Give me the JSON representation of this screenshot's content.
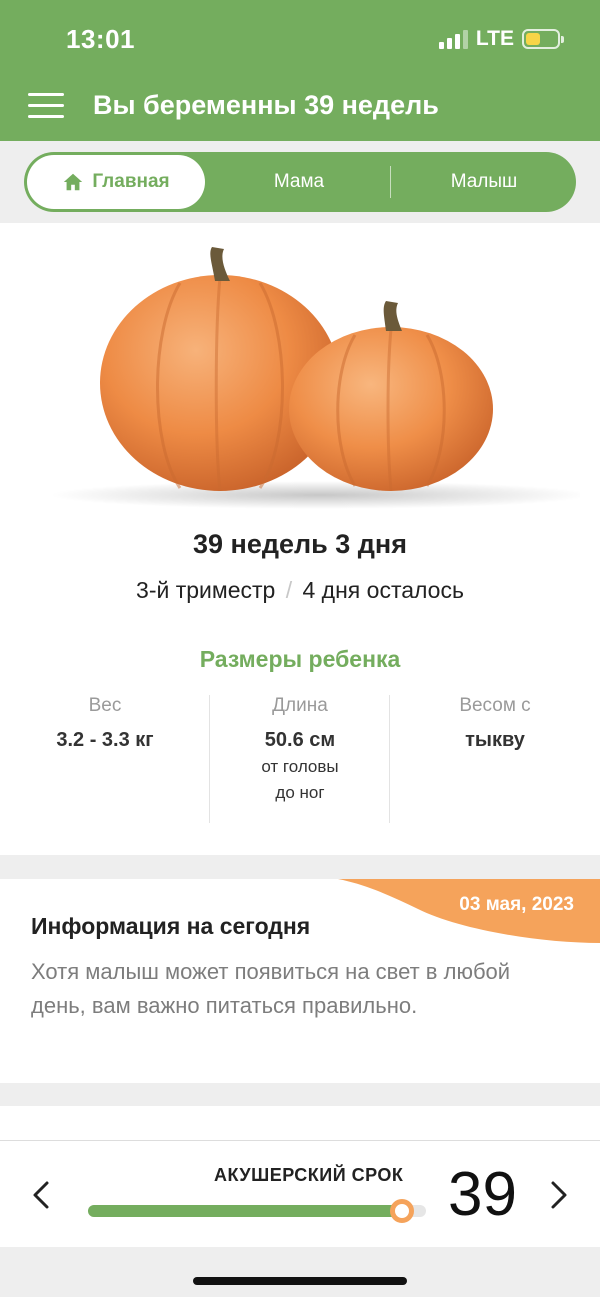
{
  "status_bar": {
    "time": "13:01",
    "network": "LTE",
    "battery_color": "#f7d548"
  },
  "header": {
    "menu_icon": "hamburger-menu-icon",
    "title": "Вы беременны 39 недель",
    "background": "#74ad5e"
  },
  "tabs": {
    "home": {
      "label": "Главная",
      "icon": "home-icon"
    },
    "mom": {
      "label": "Мама"
    },
    "baby": {
      "label": "Малыш"
    }
  },
  "week_info": {
    "image": "pumpkins-illustration",
    "title": "39 недель 3 дня",
    "trimester": "3-й триместр",
    "separator": "/",
    "remaining": "4 дня осталось"
  },
  "baby_size": {
    "heading": "Размеры ребенка",
    "weight": {
      "label": "Вес",
      "value": "3.2 - 3.3 кг"
    },
    "length": {
      "label": "Длина",
      "value": "50.6 см",
      "note_line1": "от головы",
      "note_line2": "до ног"
    },
    "compare": {
      "label": "Весом с",
      "value": "тыкву"
    }
  },
  "today_info": {
    "date": "03 мая, 2023",
    "title": "Информация на сегодня",
    "body": "Хотя малыш может появиться на свет в любой день, вам важно питаться правильно.",
    "badge_color": "#f5a35b"
  },
  "bottom_bar": {
    "prev_icon": "chevron-left-icon",
    "next_icon": "chevron-right-icon",
    "label": "АКУШЕРСКИЙ СРОК",
    "week": "39",
    "progress": 0.93,
    "accent": "#f5a35b"
  }
}
